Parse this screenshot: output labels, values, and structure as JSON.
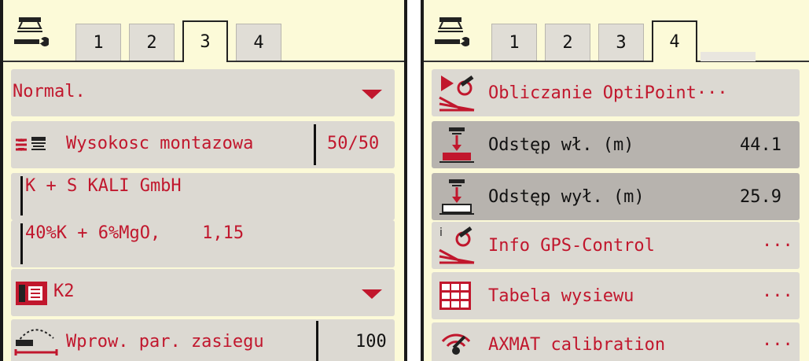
{
  "left": {
    "tabs": [
      "1",
      "2",
      "3",
      "4"
    ],
    "active_tab": "3",
    "rows": {
      "mode": "Normal.",
      "mount_label": "Wysokosc montazowa",
      "mount_value": "50/50",
      "fertilizer_maker": "K + S KALI GmbH",
      "fertilizer_type": "40%K + 6%MgO,    1,15",
      "disc": "K2",
      "range_label": "Wprow. par. zasiegu",
      "range_value": "100"
    }
  },
  "right": {
    "tabs": [
      "1",
      "2",
      "3",
      "4"
    ],
    "active_tab": "4",
    "rows": {
      "optipoint": "Obliczanie OptiPoint···",
      "distance_on_label": "Odstęp wł. (m)",
      "distance_on_value": "44.1",
      "distance_off_label": "Odstęp wył. (m)",
      "distance_off_value": "25.9",
      "gps_info": "Info GPS-Control",
      "gps_info_dots": "···",
      "table": "Tabela wysiewu",
      "table_dots": "···",
      "axmat": "AXMAT calibration",
      "axmat_dots": "···"
    }
  },
  "colors": {
    "accent": "#c1172d",
    "panel": "#fcfad8",
    "row": "#dcd9d2",
    "row_selected": "#b7b3ae"
  },
  "icons": [
    "spreader-wrench-icon",
    "mount-height-icon",
    "spreading-disc-icon",
    "throwing-range-icon",
    "optipoint-icon",
    "distance-on-icon",
    "distance-off-icon",
    "gps-info-icon",
    "spread-table-icon",
    "axmat-icon"
  ]
}
